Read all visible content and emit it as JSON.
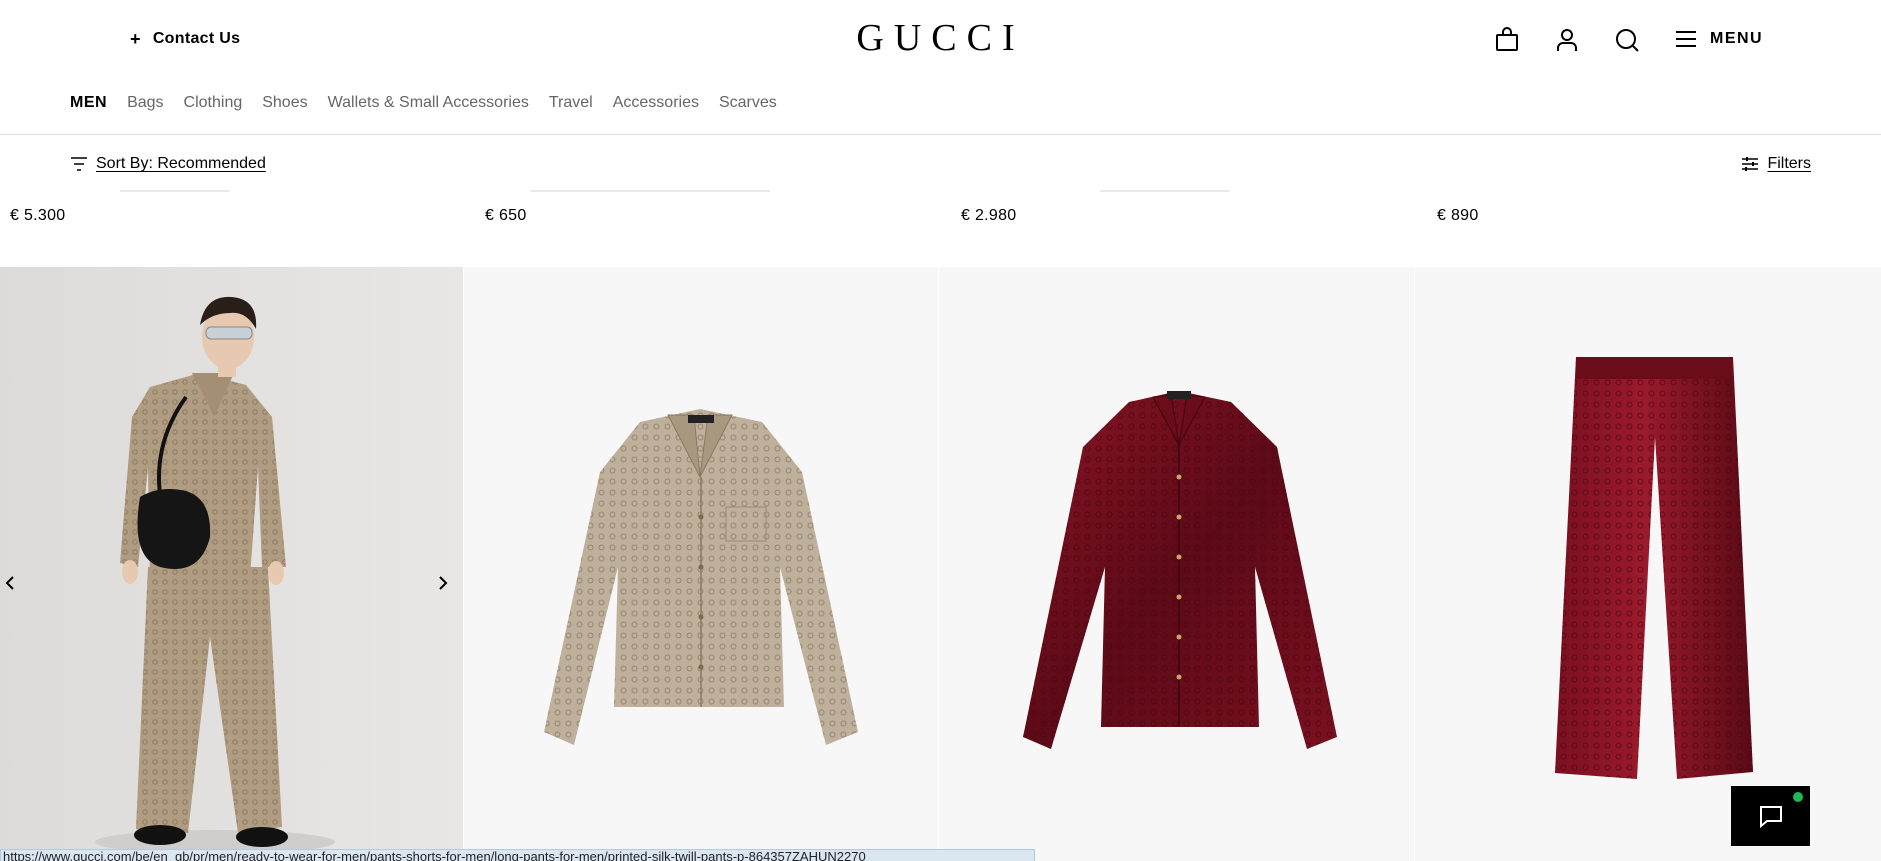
{
  "header": {
    "contact_icon": "plus-icon",
    "contact_label": "Contact Us",
    "logo": "GUCCI",
    "icons": [
      "shopping-bag-icon",
      "user-icon",
      "search-icon"
    ],
    "menu_label": "MENU",
    "menu_icon": "hamburger-icon"
  },
  "category_nav": {
    "items": [
      {
        "label": "MEN",
        "active": true
      },
      {
        "label": "Bags"
      },
      {
        "label": "Clothing"
      },
      {
        "label": "Shoes"
      },
      {
        "label": "Wallets & Small Accessories"
      },
      {
        "label": "Travel"
      },
      {
        "label": "Accessories"
      },
      {
        "label": "Scarves"
      }
    ]
  },
  "toolbar": {
    "sort_label": "Sort By: Recommended",
    "sort_icon": "sort-lines-icon",
    "filters_label": "Filters",
    "filters_icon": "sliders-icon"
  },
  "previous_row_prices": [
    "€ 5.300",
    "€ 650",
    "€ 2.980",
    "€ 890"
  ],
  "products": [
    {
      "image": "model wearing GG silk pajama shirt and pants with black shoulder bag"
    },
    {
      "image": "beige GG silk shirt"
    },
    {
      "image": "burgundy GG velvet shirt"
    },
    {
      "image": "burgundy GG velvet pants"
    }
  ],
  "carousel": {
    "prev_icon": "chevron-left-icon",
    "next_icon": "chevron-right-icon"
  },
  "chat": {
    "icon": "chat-icon",
    "status_color": "#1db954"
  },
  "status_url": "https://www.gucci.com/be/en_gb/pr/men/ready-to-wear-for-men/pants-shorts-for-men/long-pants-for-men/printed-silk-twill-pants-p-864357ZAHUN2270",
  "colors": {
    "accent": "#000000",
    "muted_text": "#666666",
    "burgundy": "#6b0a18",
    "beige": "#b7a48a"
  }
}
